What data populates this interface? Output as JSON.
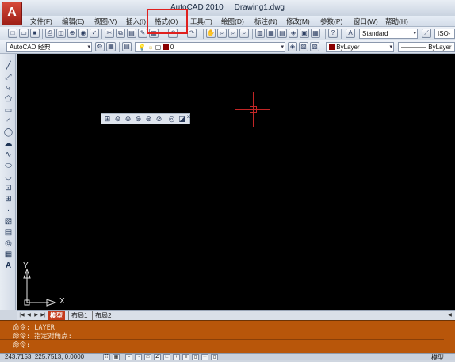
{
  "app": {
    "logo": "A",
    "title": "AutoCAD 2010",
    "filename": "Drawing1.dwg"
  },
  "menu": [
    {
      "label": "文件(F)"
    },
    {
      "label": "编辑(E)"
    },
    {
      "label": "视图(V)"
    },
    {
      "label": "插入(I)"
    },
    {
      "label": "格式(O)"
    },
    {
      "label": "工具(T)"
    },
    {
      "label": "绘图(D)"
    },
    {
      "label": "标注(N)"
    },
    {
      "label": "修改(M)"
    },
    {
      "label": "参数(P)"
    },
    {
      "label": "窗口(W)"
    },
    {
      "label": "帮助(H)"
    }
  ],
  "toolbar1": {
    "text_style": "Standard",
    "dim_style": "ISO-"
  },
  "toolbar2": {
    "workspace": "AutoCAD 经典",
    "layer": "0",
    "color": "ByLayer",
    "linetype": "ByLayer"
  },
  "ucs": {
    "y_label": "Y",
    "x_label": "X"
  },
  "tabs": [
    {
      "label": "模型"
    },
    {
      "label": "布局1"
    },
    {
      "label": "布局2"
    }
  ],
  "command": {
    "history": [
      "命令:  LAYER",
      "命令: 指定对角点:"
    ],
    "prompt": "命令:"
  },
  "status": {
    "coords": "243.7153, 225.7513, 0.0000",
    "right_label": "模型"
  },
  "colors": {
    "accent_red": "#e0201e",
    "command_bg": "#b8560a",
    "canvas_bg": "#000000",
    "layer_color": "#8b0000"
  }
}
